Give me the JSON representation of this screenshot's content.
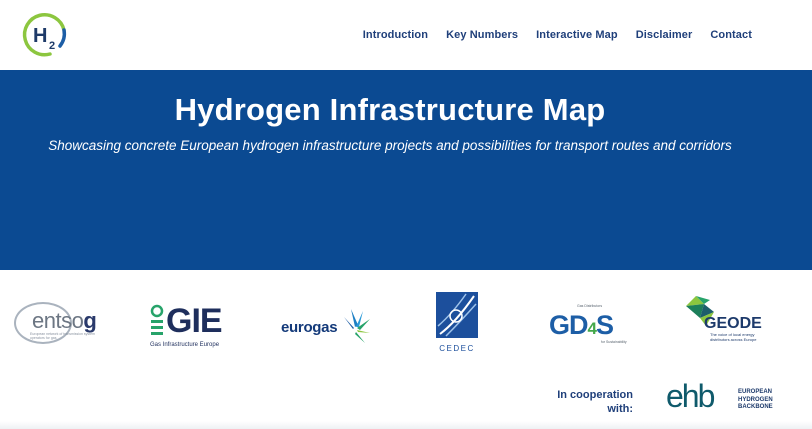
{
  "site": {
    "logo_main": "H",
    "logo_sub": "2"
  },
  "nav": {
    "items": [
      "Introduction",
      "Key Numbers",
      "Interactive Map",
      "Disclaimer",
      "Contact"
    ]
  },
  "hero": {
    "title": "Hydrogen Infrastructure Map",
    "subtitle": "Showcasing concrete European hydrogen infrastructure projects and possibilities for transport routes and corridors"
  },
  "partners": {
    "entsog": {
      "name_prefix": "entso",
      "name_suffix": "g",
      "tagline": "European network of transmission system operators for gas"
    },
    "gie": {
      "name": "GIE",
      "tagline": "Gas Infrastructure Europe"
    },
    "eurogas": {
      "name": "eurogas"
    },
    "cedec": {
      "name": "CEDEC"
    },
    "gd4s": {
      "name_a": "GD",
      "name_b": "4",
      "name_c": "S",
      "top": "Gas Distributors",
      "bottom": "for Sustainability"
    },
    "geode": {
      "name": "GEODE",
      "tagline": "The voice of local energy distributors across Europe"
    },
    "ehb": {
      "name": "ehb",
      "tagline_1": "EUROPEAN",
      "tagline_2": "HYDROGEN",
      "tagline_3": "BACKBONE"
    }
  },
  "cooperation": {
    "line1": "In cooperation",
    "line2": "with:"
  },
  "colors": {
    "hero_bg": "#0b4a92",
    "nav_text": "#1f3f7a",
    "logo_green": "#8cc63f",
    "logo_blue": "#1d5ea6"
  }
}
